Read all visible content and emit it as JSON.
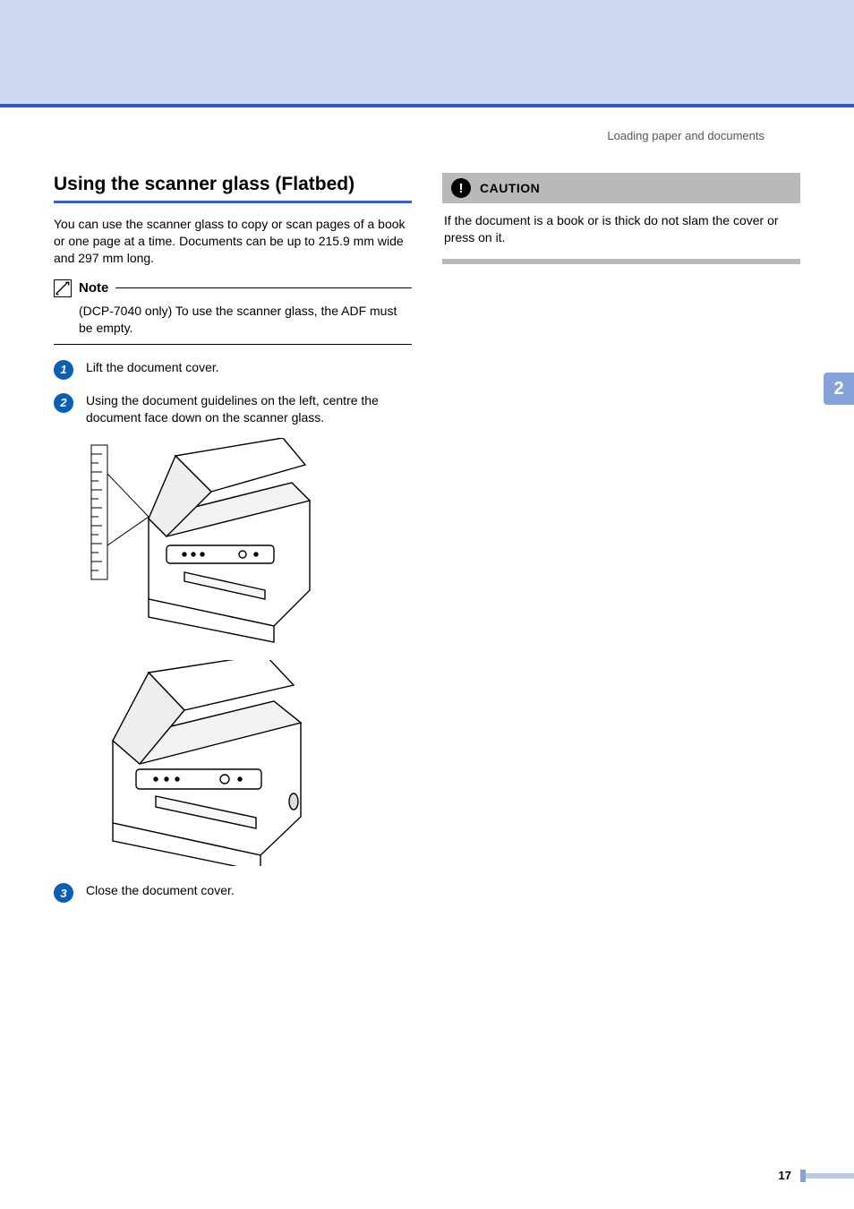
{
  "header": {
    "running_head": "Loading paper and documents"
  },
  "section": {
    "title": "Using the scanner glass (Flatbed)",
    "intro": "You can use the scanner glass to copy or scan pages of a book or one page at a time. Documents can be up to 215.9 mm wide and 297 mm long."
  },
  "note": {
    "label": "Note",
    "text": "(DCP-7040 only) To use the scanner glass, the ADF must be empty."
  },
  "steps": [
    {
      "num": "1",
      "text": "Lift the document cover."
    },
    {
      "num": "2",
      "text": "Using the document guidelines on the left, centre the document face down on the scanner glass."
    },
    {
      "num": "3",
      "text": "Close the document cover."
    }
  ],
  "caution": {
    "label": "CAUTION",
    "text": "If the document is a book or is thick do not slam the cover or press on it."
  },
  "side_tab": "2",
  "page_number": "17"
}
